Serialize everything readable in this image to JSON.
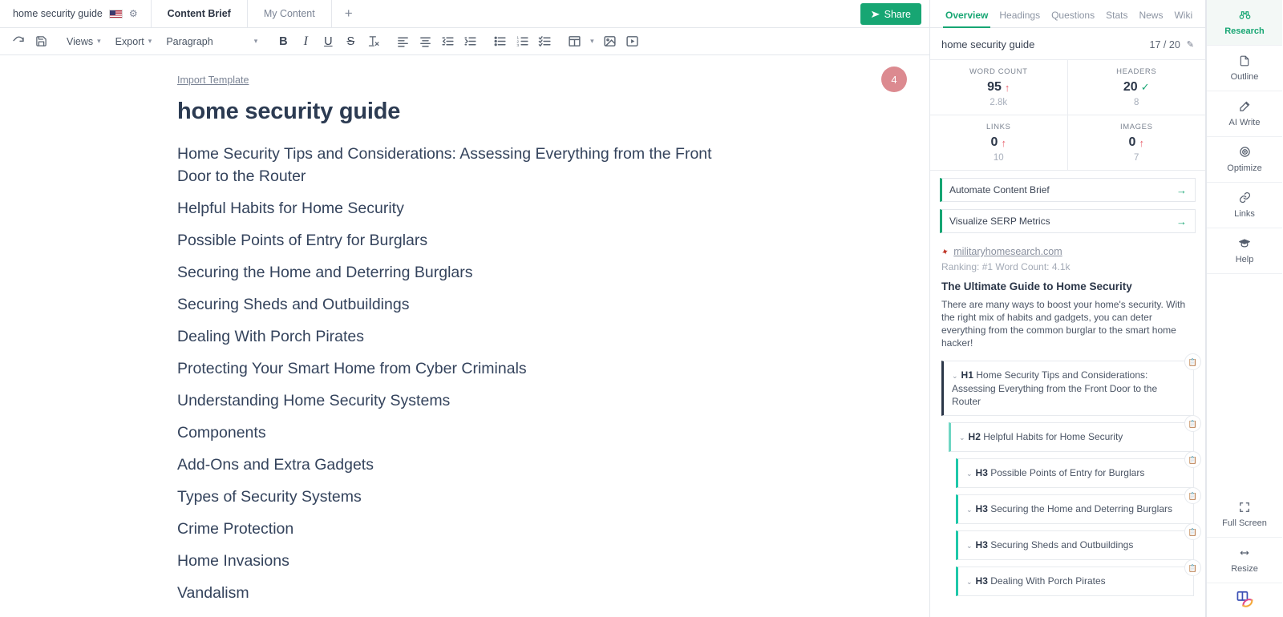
{
  "tabbar": {
    "doc_tab_label": "home security guide",
    "flag_icon": "us-flag-icon",
    "gear_icon": "gear-icon",
    "tabs": [
      {
        "label": "Content Brief",
        "active": true
      },
      {
        "label": "My Content",
        "active": false
      }
    ],
    "add_tab_label": "+",
    "share_label": "Share"
  },
  "toolbar": {
    "redo_label": "redo-icon",
    "save_label": "save-icon",
    "views_label": "Views",
    "export_label": "Export",
    "paragraph_label": "Paragraph",
    "bold_label": "B",
    "italic_label": "I",
    "underline_label": "U",
    "strike_label": "S",
    "clear_format_label": "Tx"
  },
  "document": {
    "import_template_label": "Import Template",
    "title": "home security guide",
    "badge_count": "4",
    "headings": [
      "Home Security Tips and Considerations: Assessing Everything from the Front Door to the Router",
      "Helpful Habits for Home Security",
      "Possible Points of Entry for Burglars",
      "Securing the Home and Deterring Burglars",
      "Securing Sheds and Outbuildings",
      "Dealing With Porch Pirates",
      "Protecting Your Smart Home from Cyber Criminals",
      "Understanding Home Security Systems",
      "Components",
      "Add-Ons and Extra Gadgets",
      "Types of Security Systems",
      "Crime Protection",
      "Home Invasions",
      "Vandalism"
    ]
  },
  "research": {
    "tabs": [
      {
        "label": "Overview",
        "active": true
      },
      {
        "label": "Headings",
        "active": false
      },
      {
        "label": "Questions",
        "active": false
      },
      {
        "label": "Stats",
        "active": false
      },
      {
        "label": "News",
        "active": false
      },
      {
        "label": "Wiki",
        "active": false
      }
    ],
    "keyword": "home security guide",
    "score": "17 / 20",
    "edit_icon": "pencil-icon",
    "metrics": [
      {
        "label": "WORD COUNT",
        "value": "95",
        "indicator": "up",
        "target": "2.8k"
      },
      {
        "label": "HEADERS",
        "value": "20",
        "indicator": "check",
        "target": "8"
      },
      {
        "label": "LINKS",
        "value": "0",
        "indicator": "up",
        "target": "10"
      },
      {
        "label": "IMAGES",
        "value": "0",
        "indicator": "up",
        "target": "7"
      }
    ],
    "actions": [
      {
        "label": "Automate Content Brief"
      },
      {
        "label": "Visualize SERP Metrics"
      }
    ],
    "serp": {
      "domain": "militaryhomesearch.com",
      "meta": "Ranking: #1   Word Count: 4.1k",
      "title": "The Ultimate Guide to Home Security",
      "description": "There are many ways to boost your home's security. With the right mix of habits and gadgets, you can deter everything from the common burglar to the smart home hacker!"
    },
    "headings": [
      {
        "level": "H1",
        "text": "Home Security Tips and Considerations: Assessing Everything from the Front Door to the Router"
      },
      {
        "level": "H2",
        "text": "Helpful Habits for Home Security"
      },
      {
        "level": "H3",
        "text": "Possible Points of Entry for Burglars"
      },
      {
        "level": "H3",
        "text": "Securing the Home and Deterring Burglars"
      },
      {
        "level": "H3",
        "text": "Securing Sheds and Outbuildings"
      },
      {
        "level": "H3",
        "text": "Dealing With Porch Pirates"
      }
    ]
  },
  "rail": {
    "items": [
      {
        "label": "Research",
        "icon": "binoculars-icon",
        "active": true
      },
      {
        "label": "Outline",
        "icon": "document-icon",
        "active": false
      },
      {
        "label": "AI Write",
        "icon": "magic-wand-icon",
        "active": false
      },
      {
        "label": "Optimize",
        "icon": "target-icon",
        "active": false
      },
      {
        "label": "Links",
        "icon": "link-icon",
        "active": false
      },
      {
        "label": "Help",
        "icon": "graduation-cap-icon",
        "active": false
      }
    ],
    "bottom_items": [
      {
        "label": "Full Screen",
        "icon": "expand-icon"
      },
      {
        "label": "Resize",
        "icon": "horizontal-arrows-icon"
      }
    ]
  },
  "colors": {
    "accent_green": "#17a673",
    "teal": "#1fc8a9",
    "red": "#e8616d",
    "badge_pink": "#dc8a90",
    "dark_navy": "#2b3648"
  }
}
